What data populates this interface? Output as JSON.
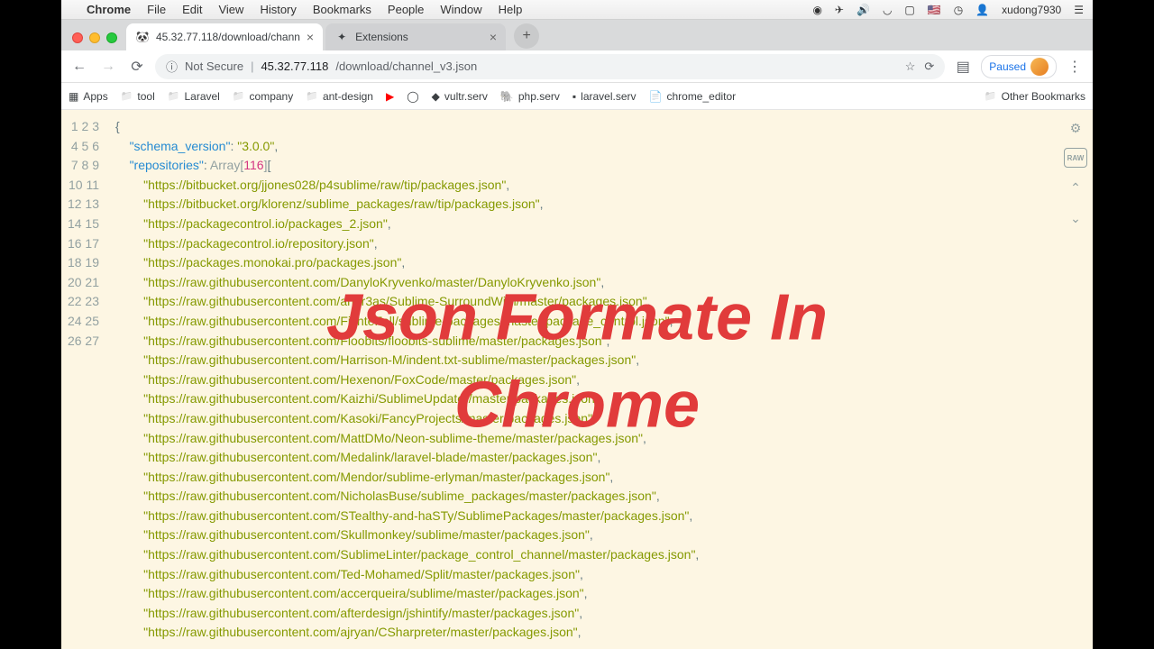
{
  "menubar": {
    "app": "Chrome",
    "items": [
      "File",
      "Edit",
      "View",
      "History",
      "Bookmarks",
      "People",
      "Window",
      "Help"
    ],
    "right_user": "xudong7930"
  },
  "tabs": [
    {
      "title": "45.32.77.118/download/chann",
      "favicon": "json",
      "active": true
    },
    {
      "title": "Extensions",
      "favicon": "ext",
      "active": false
    }
  ],
  "omnibox": {
    "not_secure": "Not Secure",
    "host": "45.32.77.118",
    "path": "/download/channel_v3.json"
  },
  "profile_chip": "Paused",
  "bookmarks": {
    "items": [
      "Apps",
      "tool",
      "Laravel",
      "company",
      "ant-design",
      "",
      "",
      "vultr.serv",
      "php.serv",
      "laravel.serv",
      "chrome_editor"
    ],
    "other": "Other Bookmarks"
  },
  "json": {
    "schema_version_key": "\"schema_version\"",
    "schema_version_val": "\"3.0.0\"",
    "repositories_key": "\"repositories\"",
    "array_label": "Array",
    "array_count": "116",
    "urls": [
      "\"https://bitbucket.org/jjones028/p4sublime/raw/tip/packages.json\"",
      "\"https://bitbucket.org/klorenz/sublime_packages/raw/tip/packages.json\"",
      "\"https://packagecontrol.io/packages_2.json\"",
      "\"https://packagecontrol.io/repository.json\"",
      "\"https://packages.monokai.pro/packages.json\"",
      "\"https://raw.githubusercontent.com/DanyloKryvenko/master/DanyloKryvenko.json\"",
      "\"https://raw.githubusercontent.com/andr3as/Sublime-SurroundWith/master/packages.json\"",
      "\"https://raw.githubusercontent.com/FichteFoll/sublime-packages/master/package_control.json\"",
      "\"https://raw.githubusercontent.com/Floobits/floobits-sublime/master/packages.json\"",
      "\"https://raw.githubusercontent.com/Harrison-M/indent.txt-sublime/master/packages.json\"",
      "\"https://raw.githubusercontent.com/Hexenon/FoxCode/master/packages.json\"",
      "\"https://raw.githubusercontent.com/Kaizhi/SublimeUpdater/master/packages.json\"",
      "\"https://raw.githubusercontent.com/Kasoki/FancyProjects/master/packages.json\"",
      "\"https://raw.githubusercontent.com/MattDMo/Neon-sublime-theme/master/packages.json\"",
      "\"https://raw.githubusercontent.com/Medalink/laravel-blade/master/packages.json\"",
      "\"https://raw.githubusercontent.com/Mendor/sublime-erlyman/master/packages.json\"",
      "\"https://raw.githubusercontent.com/NicholasBuse/sublime_packages/master/packages.json\"",
      "\"https://raw.githubusercontent.com/STealthy-and-haSTy/SublimePackages/master/packages.json\"",
      "\"https://raw.githubusercontent.com/Skullmonkey/sublime/master/packages.json\"",
      "\"https://raw.githubusercontent.com/SublimeLinter/package_control_channel/master/packages.json\"",
      "\"https://raw.githubusercontent.com/Ted-Mohamed/Split/master/packages.json\"",
      "\"https://raw.githubusercontent.com/accerqueira/sublime/master/packages.json\"",
      "\"https://raw.githubusercontent.com/afterdesign/jshintify/master/packages.json\"",
      "\"https://raw.githubusercontent.com/ajryan/CSharpreter/master/packages.json\""
    ]
  },
  "overlay_line1": "Json Formate In",
  "overlay_line2": "Chrome",
  "raw_label": "RAW"
}
